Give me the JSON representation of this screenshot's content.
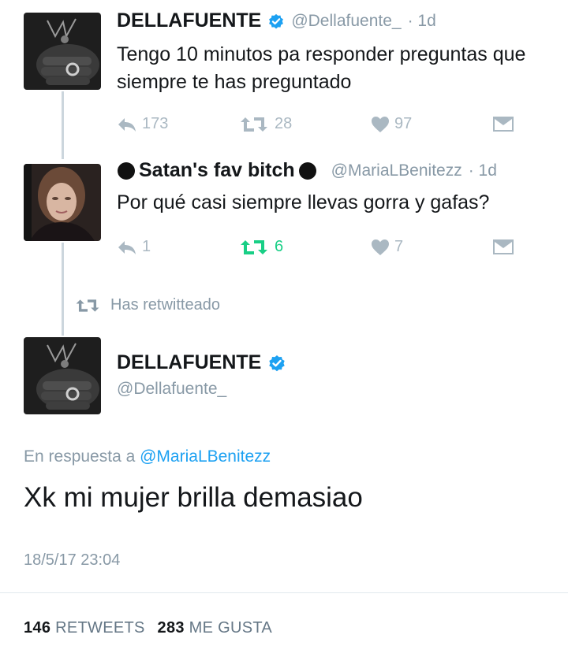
{
  "tweet1": {
    "name": "DELLAFUENTE",
    "handle": "@Dellafuente_",
    "time": "· 1d",
    "text": "Tengo 10 minutos pa responder preguntas que siempre te has preguntado",
    "replies": "173",
    "retweets": "28",
    "likes": "97"
  },
  "tweet2": {
    "name": "Satan's fav bitch",
    "handle": "@MariaLBenitezz",
    "time": "· 1d",
    "text": "Por qué casi siempre llevas gorra y gafas?",
    "replies": "1",
    "retweets": "6",
    "likes": "7"
  },
  "retweeted_label": "Has retwitteado",
  "main_tweet": {
    "name": "DELLAFUENTE",
    "handle": "@Dellafuente_",
    "reply_prefix": "En respuesta a",
    "reply_handle": "@MariaLBenitezz",
    "text": "Xk mi mujer brilla demasiao",
    "timestamp": "18/5/17 23:04",
    "retweet_count": "146",
    "retweet_label": "RETWEETS",
    "like_count": "283",
    "like_label": "ME GUSTA"
  },
  "colors": {
    "verified": "#1da1f2",
    "retweet_active": "#19cf86",
    "link": "#1da1f2",
    "muted": "#8899a6"
  }
}
